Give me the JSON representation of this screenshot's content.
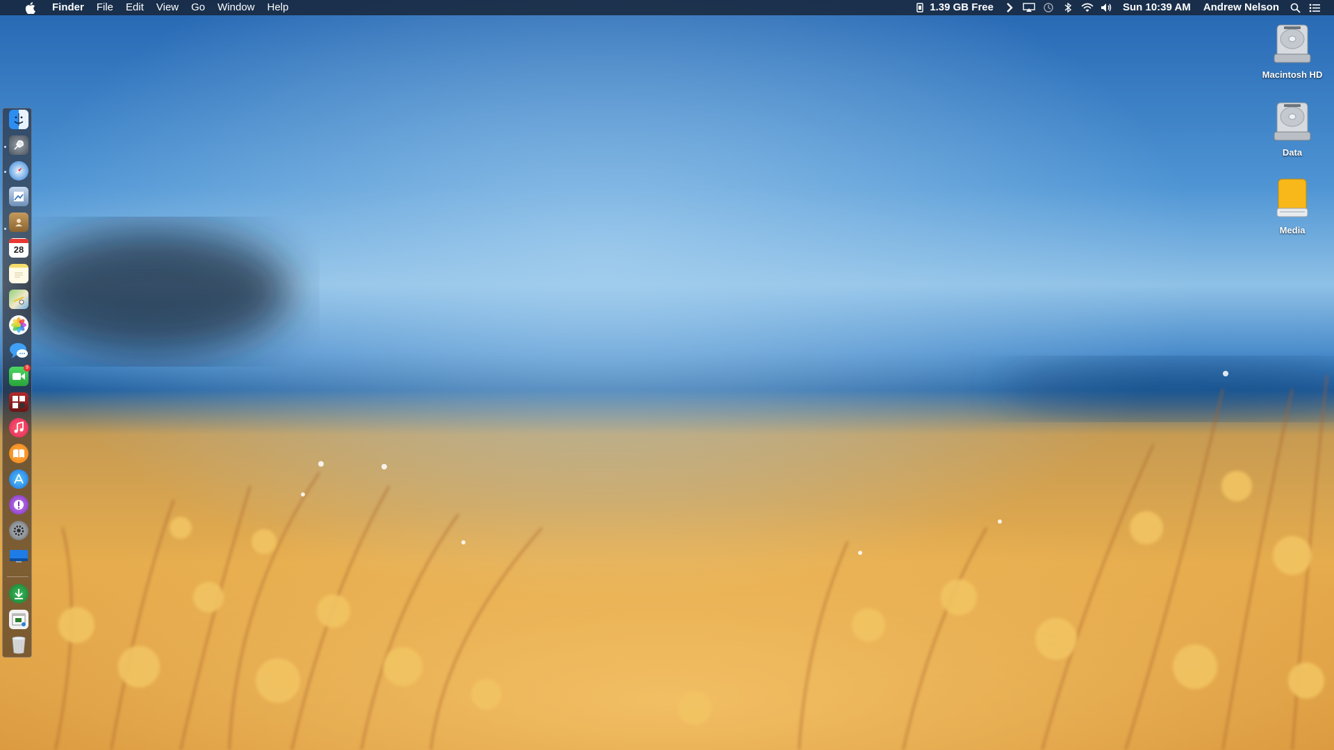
{
  "menubar": {
    "app_name": "Finder",
    "menus": [
      "File",
      "Edit",
      "View",
      "Go",
      "Window",
      "Help"
    ],
    "memory_text": "1.39 GB Free",
    "clock": "Sun 10:39 AM",
    "user": "Andrew Nelson"
  },
  "dock": {
    "items": [
      {
        "name": "finder",
        "icon": "finder-icon"
      },
      {
        "name": "launchpad",
        "icon": "rocket-icon"
      },
      {
        "name": "safari",
        "icon": "compass-icon"
      },
      {
        "name": "preview",
        "icon": "preview-icon"
      },
      {
        "name": "contacts",
        "icon": "contacts-icon"
      },
      {
        "name": "calendar",
        "icon": "calendar-icon",
        "label": "28"
      },
      {
        "name": "notes",
        "icon": "notes-icon"
      },
      {
        "name": "maps",
        "icon": "maps-icon"
      },
      {
        "name": "photos",
        "icon": "photos-icon"
      },
      {
        "name": "messages",
        "icon": "messages-icon"
      },
      {
        "name": "facetime",
        "icon": "facetime-icon",
        "badge": "9"
      },
      {
        "name": "photo-booth",
        "icon": "photo-booth-icon"
      },
      {
        "name": "itunes",
        "icon": "music-icon"
      },
      {
        "name": "ibooks",
        "icon": "book-icon"
      },
      {
        "name": "app-store",
        "icon": "app-store-icon"
      },
      {
        "name": "feedback",
        "icon": "exclamation-icon"
      },
      {
        "name": "system-preferences",
        "icon": "gear-icon"
      },
      {
        "name": "desktop",
        "icon": "screen-icon"
      },
      {
        "name": "downloads",
        "icon": "download-icon"
      },
      {
        "name": "activity",
        "icon": "window-icon"
      },
      {
        "name": "trash",
        "icon": "trash-icon"
      }
    ]
  },
  "desktop": {
    "icons": [
      {
        "label": "Macintosh HD",
        "icon": "hard-drive-icon"
      },
      {
        "label": "Data",
        "icon": "hard-drive-icon"
      },
      {
        "label": "Media",
        "icon": "external-drive-icon"
      }
    ]
  },
  "colors": {
    "sky_top": "#2a6db6",
    "sky_mid": "#8fc1e6",
    "sea": "#1e5a97",
    "field": "#e3a84a",
    "menubar": "#162234"
  }
}
